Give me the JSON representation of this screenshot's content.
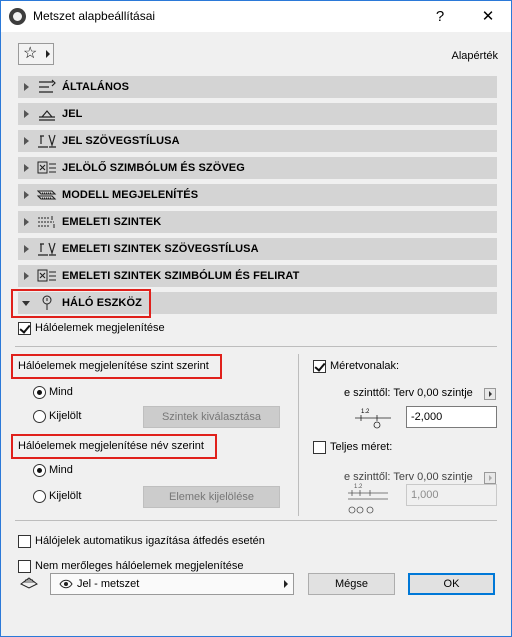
{
  "window": {
    "title": "Metszet alapbeállításai",
    "help": "?",
    "close": "✕"
  },
  "toolbar": {
    "default_label": "Alapérték"
  },
  "panels": [
    {
      "label": "ÁLTALÁNOS",
      "icon": "general-settings-icon"
    },
    {
      "label": "JEL",
      "icon": "marker-icon"
    },
    {
      "label": "JEL SZÖVEGSTÍLUSA",
      "icon": "text-style-icon"
    },
    {
      "label": "JELÖLŐ SZIMBÓLUM ÉS SZÖVEG",
      "icon": "symbol-text-icon"
    },
    {
      "label": "MODELL MEGJELENÍTÉS",
      "icon": "model-display-icon"
    },
    {
      "label": "EMELETI SZINTEK",
      "icon": "story-levels-icon"
    },
    {
      "label": "EMELETI SZINTEK SZÖVEGSTÍLUSA",
      "icon": "text-style-icon"
    },
    {
      "label": "EMELETI SZINTEK SZIMBÓLUM ÉS FELIRAT",
      "icon": "symbol-text-icon"
    },
    {
      "label": "HÁLÓ ESZKÖZ",
      "icon": "grid-tool-icon"
    }
  ],
  "grid": {
    "show_grid": "Hálóelemek megjelenítése",
    "by_story_title": "Hálóelemek megjelenítése szint szerint",
    "by_story_all": "Mind",
    "by_story_selected": "Kijelölt",
    "select_stories_btn": "Szintek kiválasztása",
    "by_name_title": "Hálóelemek megjelenítése név szerint",
    "by_name_all": "Mind",
    "by_name_selected": "Kijelölt",
    "select_elements_btn": "Elemek kijelölése",
    "dimension_lines": "Méretvonalak:",
    "from_story_1": "e szinttől: Terv 0,00 szintje",
    "value_1": "-2,000",
    "overall_dimension": "Teljes méret:",
    "from_story_2": "e szinttől: Terv 0,00 szintje",
    "value_2": "1,000",
    "auto_adjust": "Hálójelek automatikus igazítása átfedés esetén",
    "non_ortho": "Nem merőleges hálóelemek megjelenítése"
  },
  "footer": {
    "layer_combo": "Jel - metszet",
    "cancel": "Mégse",
    "ok": "OK"
  }
}
